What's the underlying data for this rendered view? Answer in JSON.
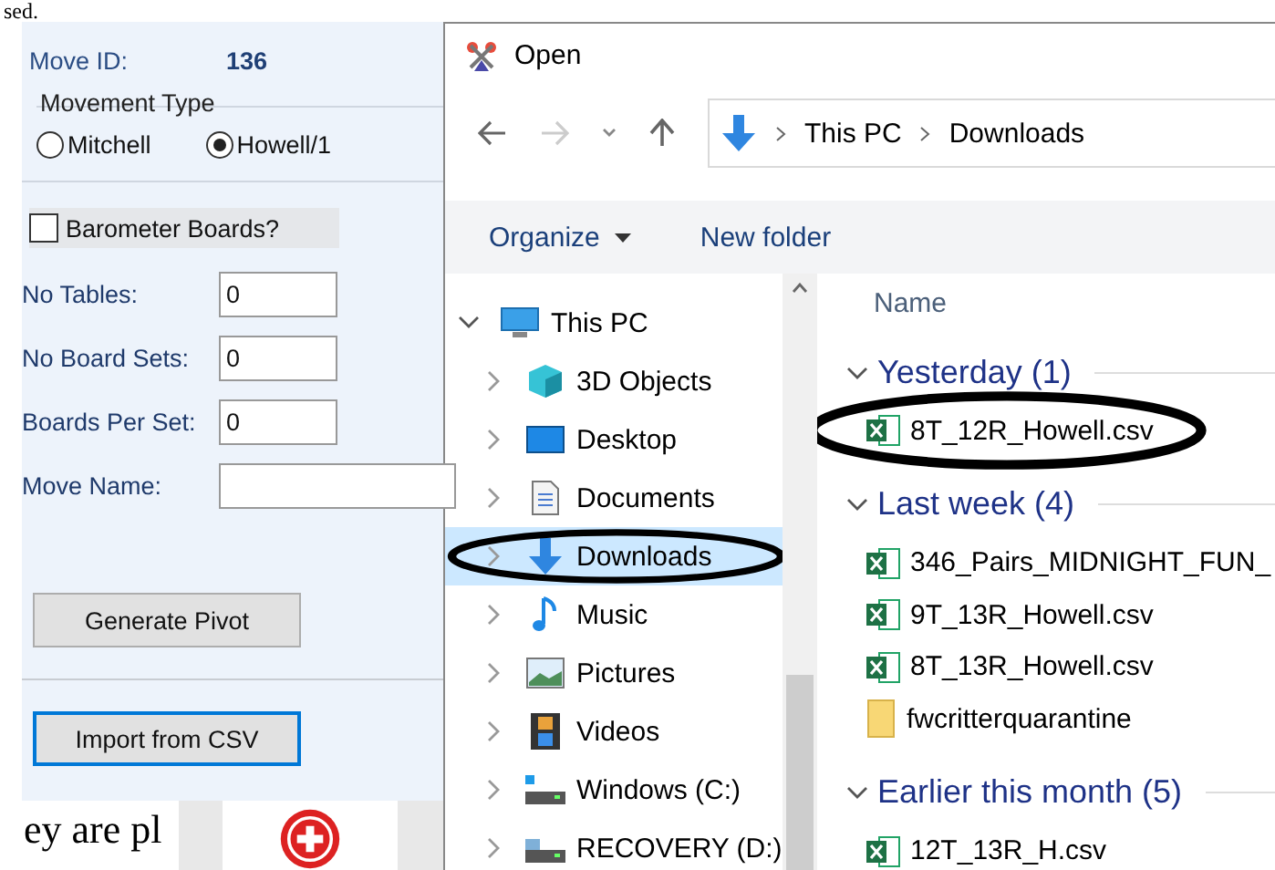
{
  "background": {
    "top_text": "sed.",
    "bottom_text": "ey are pl"
  },
  "form": {
    "move_id_label": "Move ID:",
    "move_id": "136",
    "movement_type": {
      "label": "Movement Type",
      "options": [
        {
          "label": "Mitchell",
          "selected": false
        },
        {
          "label": "Howell/1",
          "selected": true
        }
      ]
    },
    "barometer": {
      "label": "Barometer Boards?",
      "checked": false
    },
    "fields": [
      {
        "label": "No Tables:",
        "value": "0"
      },
      {
        "label": "No Board Sets:",
        "value": "0"
      },
      {
        "label": "Boards Per Set:",
        "value": "0"
      },
      {
        "label": "Move Name:"
      }
    ],
    "buttons": [
      {
        "label": "Generate Pivot",
        "focused": false
      },
      {
        "label": "Import from CSV",
        "focused": true
      }
    ]
  },
  "dialog": {
    "title": "Open",
    "breadcrumb": [
      "This PC",
      "Downloads"
    ],
    "toolbar": {
      "organize": "Organize",
      "new_folder": "New folder"
    },
    "nav": [
      {
        "label": "This PC",
        "kind": "pc",
        "expanded": true,
        "selected": false,
        "circled": false,
        "children": [
          {
            "label": "3D Objects",
            "kind": "cube",
            "expanded": false,
            "selected": false,
            "circled": false
          },
          {
            "label": "Desktop",
            "kind": "desktop",
            "expanded": false,
            "selected": false,
            "circled": false
          },
          {
            "label": "Documents",
            "kind": "documents",
            "expanded": false,
            "selected": false,
            "circled": false
          },
          {
            "label": "Downloads",
            "kind": "downloads",
            "expanded": false,
            "selected": true,
            "circled": true
          },
          {
            "label": "Music",
            "kind": "music",
            "expanded": false,
            "selected": false,
            "circled": false
          },
          {
            "label": "Pictures",
            "kind": "pictures",
            "expanded": false,
            "selected": false,
            "circled": false
          },
          {
            "label": "Videos",
            "kind": "videos",
            "expanded": false,
            "selected": false,
            "circled": false
          },
          {
            "label": "Windows (C:)",
            "kind": "drive",
            "expanded": false,
            "selected": false,
            "circled": false
          },
          {
            "label": "RECOVERY (D:)",
            "kind": "recovery",
            "expanded": false,
            "selected": false,
            "circled": false
          }
        ]
      }
    ],
    "column_header": "Name",
    "groups": [
      {
        "label": "Yesterday (1)",
        "expanded": true,
        "files": [
          {
            "name": "8T_12R_Howell.csv",
            "kind": "csv",
            "circled": true
          }
        ]
      },
      {
        "label": "Last week (4)",
        "expanded": true,
        "files": [
          {
            "name": "346_Pairs_MIDNIGHT_FUN_",
            "kind": "csv",
            "circled": false
          },
          {
            "name": "9T_13R_Howell.csv",
            "kind": "csv",
            "circled": false
          },
          {
            "name": "8T_13R_Howell.csv",
            "kind": "csv",
            "circled": false
          },
          {
            "name": "fwcritterquarantine",
            "kind": "folder",
            "circled": false
          }
        ]
      },
      {
        "label": "Earlier this month (5)",
        "expanded": true,
        "files": [
          {
            "name": "12T_13R_H.csv",
            "kind": "csv",
            "circled": false
          }
        ]
      }
    ]
  }
}
